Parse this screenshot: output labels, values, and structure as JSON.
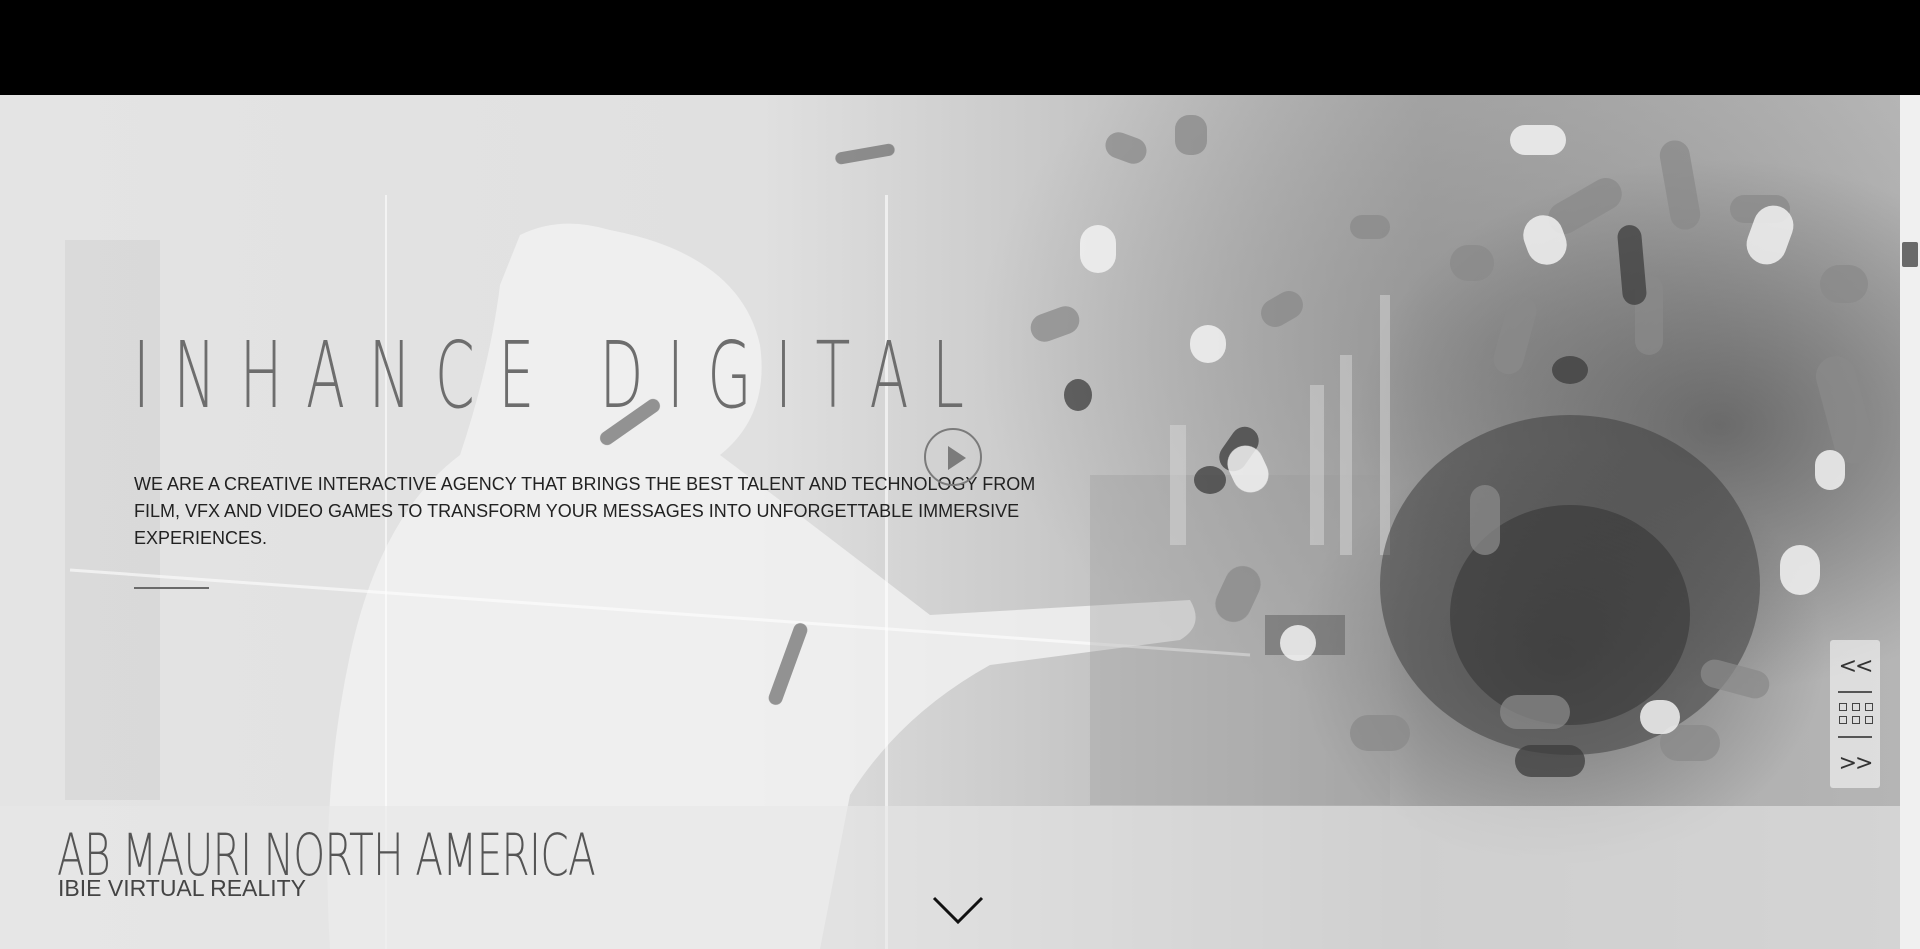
{
  "hero": {
    "title": "INHANCE DIGITAL",
    "intro": "WE ARE A CREATIVE INTERACTIVE AGENCY THAT BRINGS THE BEST TALENT AND TECHNOLOGY FROM FILM, VFX AND VIDEO GAMES TO TRANSFORM YOUR MESSAGES INTO UNFORGETTABLE IMMERSIVE EXPERIENCES."
  },
  "pager": {
    "prev_label": "<<",
    "next_label": ">>"
  },
  "project": {
    "client": "AB MAURI NORTH AMERICA",
    "name": "IBIE VIRTUAL REALITY"
  },
  "icons": {
    "play": "play-icon",
    "prev": "chevron-double-left-icon",
    "grid": "grid-icon",
    "next": "chevron-double-right-icon",
    "scroll_down": "chevron-down-icon"
  }
}
